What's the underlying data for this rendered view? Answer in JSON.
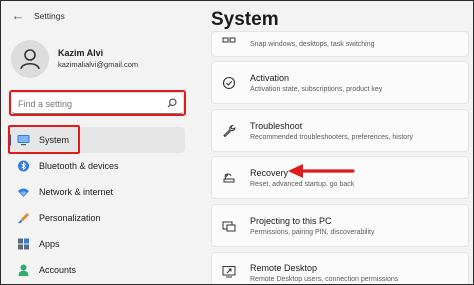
{
  "window": {
    "title": "Settings"
  },
  "profile": {
    "name": "Kazim Alvi",
    "email": "kazimalialvi@gmail.com"
  },
  "search": {
    "placeholder": "Find a setting"
  },
  "nav": {
    "items": [
      {
        "label": "System",
        "icon": "monitor-icon"
      },
      {
        "label": "Bluetooth & devices",
        "icon": "bluetooth-icon"
      },
      {
        "label": "Network & internet",
        "icon": "wifi-icon"
      },
      {
        "label": "Personalization",
        "icon": "brush-icon"
      },
      {
        "label": "Apps",
        "icon": "apps-grid-icon"
      },
      {
        "label": "Accounts",
        "icon": "person-icon"
      }
    ]
  },
  "main": {
    "title": "System",
    "cards": [
      {
        "title": "",
        "desc": "Snap windows, desktops, task switching",
        "icon": "multitasking-icon"
      },
      {
        "title": "Activation",
        "desc": "Activation state, subscriptions, product key",
        "icon": "check-circle-icon"
      },
      {
        "title": "Troubleshoot",
        "desc": "Recommended troubleshooters, preferences, history",
        "icon": "wrench-icon"
      },
      {
        "title": "Recovery",
        "desc": "Reset, advanced startup, go back",
        "icon": "recovery-icon"
      },
      {
        "title": "Projecting to this PC",
        "desc": "Permissions, pairing PIN, discoverability",
        "icon": "projector-icon"
      },
      {
        "title": "Remote Desktop",
        "desc": "Remote Desktop users, connection permissions",
        "icon": "remote-desktop-icon"
      }
    ]
  },
  "colors": {
    "accent": "#0067c0",
    "highlight": "#e01b1b"
  }
}
